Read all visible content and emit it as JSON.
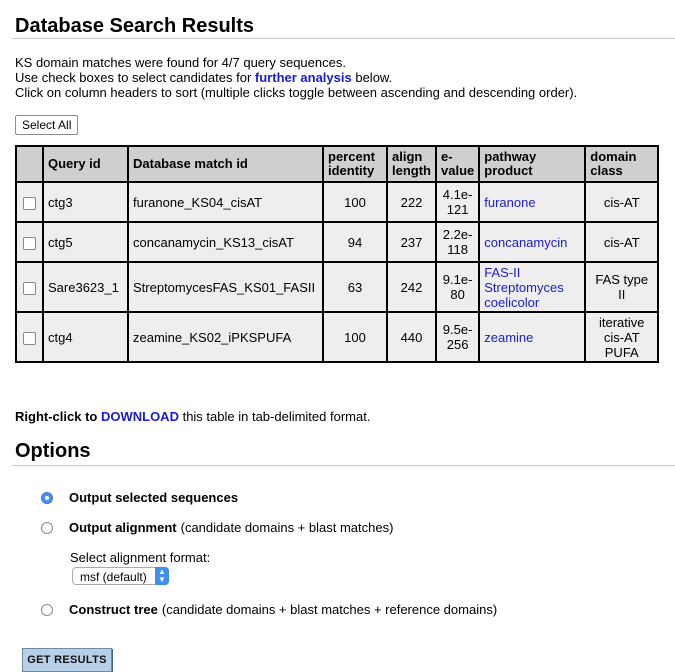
{
  "page": {
    "title": "Database Search Results"
  },
  "intro": {
    "line1": "KS domain matches were found for 4/7 query sequences.",
    "line2_pre": "Use check boxes to select candidates for ",
    "line2_link": "further analysis",
    "line2_post": " below.",
    "line3": "Click on column headers to sort (multiple clicks toggle between ascending and descending order)."
  },
  "select_all_label": "Select All",
  "table": {
    "headers": {
      "query": "Query id",
      "match": "Database match id",
      "identity_1": "percent",
      "identity_2": "identity",
      "align_1": "align",
      "align_2": "length",
      "evalue_1": "e-",
      "evalue_2": "value",
      "pathway_1": "pathway",
      "pathway_2": "product",
      "domain_1": "domain",
      "domain_2": "class"
    },
    "rows": [
      {
        "query": "ctg3",
        "match": "furanone_KS04_cisAT",
        "identity": "100",
        "align": "222",
        "evalue_1": "4.1e-",
        "evalue_2": "121",
        "pathway_1": "furanone",
        "pathway_2": "",
        "pathway_3": "",
        "domain_1": "cis-AT",
        "domain_2": "",
        "domain_3": ""
      },
      {
        "query": "ctg5",
        "match": "concanamycin_KS13_cisAT",
        "identity": "94",
        "align": "237",
        "evalue_1": "2.2e-",
        "evalue_2": "118",
        "pathway_1": "concanamycin",
        "pathway_2": "",
        "pathway_3": "",
        "domain_1": "cis-AT",
        "domain_2": "",
        "domain_3": ""
      },
      {
        "query": "Sare3623_1",
        "match": "StreptomycesFAS_KS01_FASII",
        "identity": "63",
        "align": "242",
        "evalue_1": "9.1e-",
        "evalue_2": "80",
        "pathway_1": "FAS-II",
        "pathway_2": "Streptomyces",
        "pathway_3": "coelicolor",
        "domain_1": "FAS type",
        "domain_2": "II",
        "domain_3": ""
      },
      {
        "query": "ctg4",
        "match": "zeamine_KS02_iPKSPUFA",
        "identity": "100",
        "align": "440",
        "evalue_1": "9.5e-",
        "evalue_2": "256",
        "pathway_1": "zeamine",
        "pathway_2": "",
        "pathway_3": "",
        "domain_1": "iterative",
        "domain_2": "cis-AT",
        "domain_3": "PUFA"
      }
    ]
  },
  "download": {
    "pre": "Right-click to",
    "link": "DOWNLOAD",
    "post": " this table in tab-delimited format."
  },
  "options": {
    "title": "Options",
    "opt1_bold": "Output selected sequences",
    "opt1_rest": "",
    "opt2_bold": "Output alignment",
    "opt2_rest": "(candidate domains + blast matches)",
    "select_label": "Select alignment format:",
    "select_value": "msf (default)",
    "opt3_bold": "Construct tree",
    "opt3_rest": "(candidate domains + blast matches + reference domains)"
  },
  "submit_label": "GET RESULTS",
  "colors": {
    "link": "#1a1ad8",
    "header_bg": "#cfcfcf",
    "table_bg": "#eeeeee",
    "radio_on": "#4a8ff0",
    "button_bg": "#b8cfe8"
  }
}
